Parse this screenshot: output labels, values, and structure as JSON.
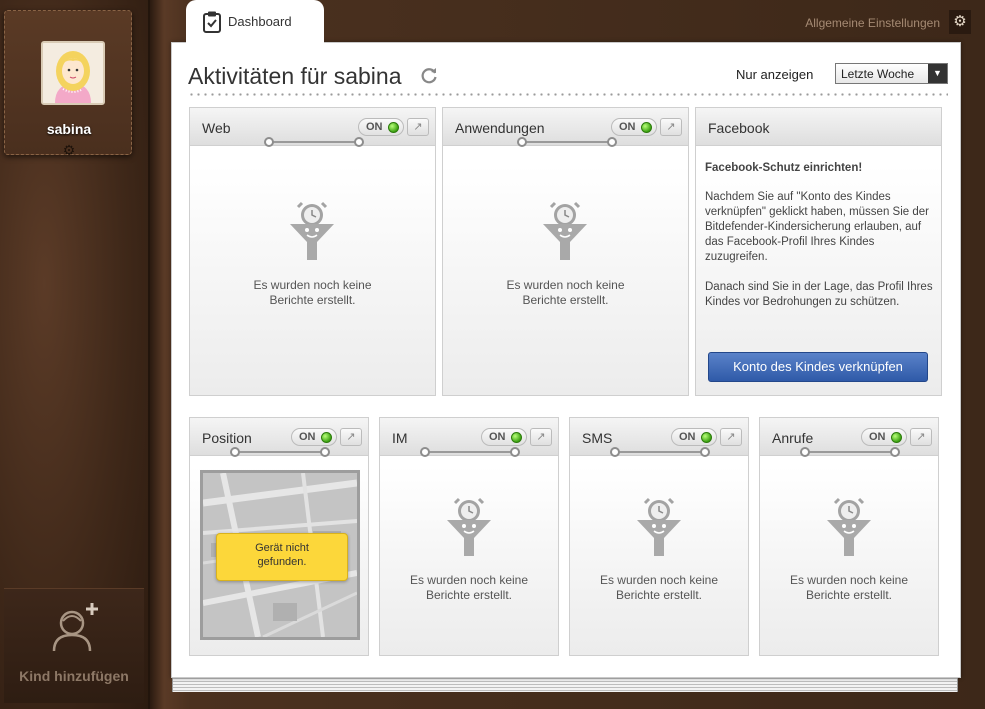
{
  "profile": {
    "name": "sabina"
  },
  "sidebar": {
    "add_child_label": "Kind hinzufügen"
  },
  "header": {
    "settings_label": "Allgemeine Einstellungen"
  },
  "tab": {
    "label": "Dashboard"
  },
  "page": {
    "title": "Aktivitäten für sabina",
    "filter_label": "Nur anzeigen",
    "filter_value": "Letzte Woche"
  },
  "cards": {
    "web": {
      "title": "Web",
      "toggle": "ON",
      "empty": [
        "Es wurden noch keine",
        "Berichte erstellt."
      ]
    },
    "apps": {
      "title": "Anwendungen",
      "toggle": "ON",
      "empty": [
        "Es wurden noch keine",
        "Berichte erstellt."
      ]
    },
    "facebook": {
      "title": "Facebook",
      "heading": "Facebook-Schutz einrichten!",
      "para1": "Nachdem Sie auf \"Konto des Kindes verknüpfen\" geklickt haben, müssen Sie der Bitdefender-Kindersicherung erlauben, auf das Facebook-Profil Ihres Kindes zuzugreifen.",
      "para2": "Danach sind Sie in der Lage, das Profil Ihres Kindes vor Bedrohungen zu schützen.",
      "button": "Konto des Kindes verknüpfen"
    },
    "position": {
      "title": "Position",
      "toggle": "ON",
      "popup": [
        "Gerät nicht",
        "gefunden."
      ]
    },
    "im": {
      "title": "IM",
      "toggle": "ON",
      "empty": [
        "Es wurden noch keine",
        "Berichte erstellt."
      ]
    },
    "sms": {
      "title": "SMS",
      "toggle": "ON",
      "empty": [
        "Es wurden noch keine",
        "Berichte erstellt."
      ]
    },
    "calls": {
      "title": "Anrufe",
      "toggle": "ON",
      "empty": [
        "Es wurden noch keine",
        "Berichte erstellt."
      ]
    }
  },
  "colors": {
    "led_on": "#3da312",
    "facebook_button": "#3a63b0",
    "popup": "#fcd73a"
  }
}
